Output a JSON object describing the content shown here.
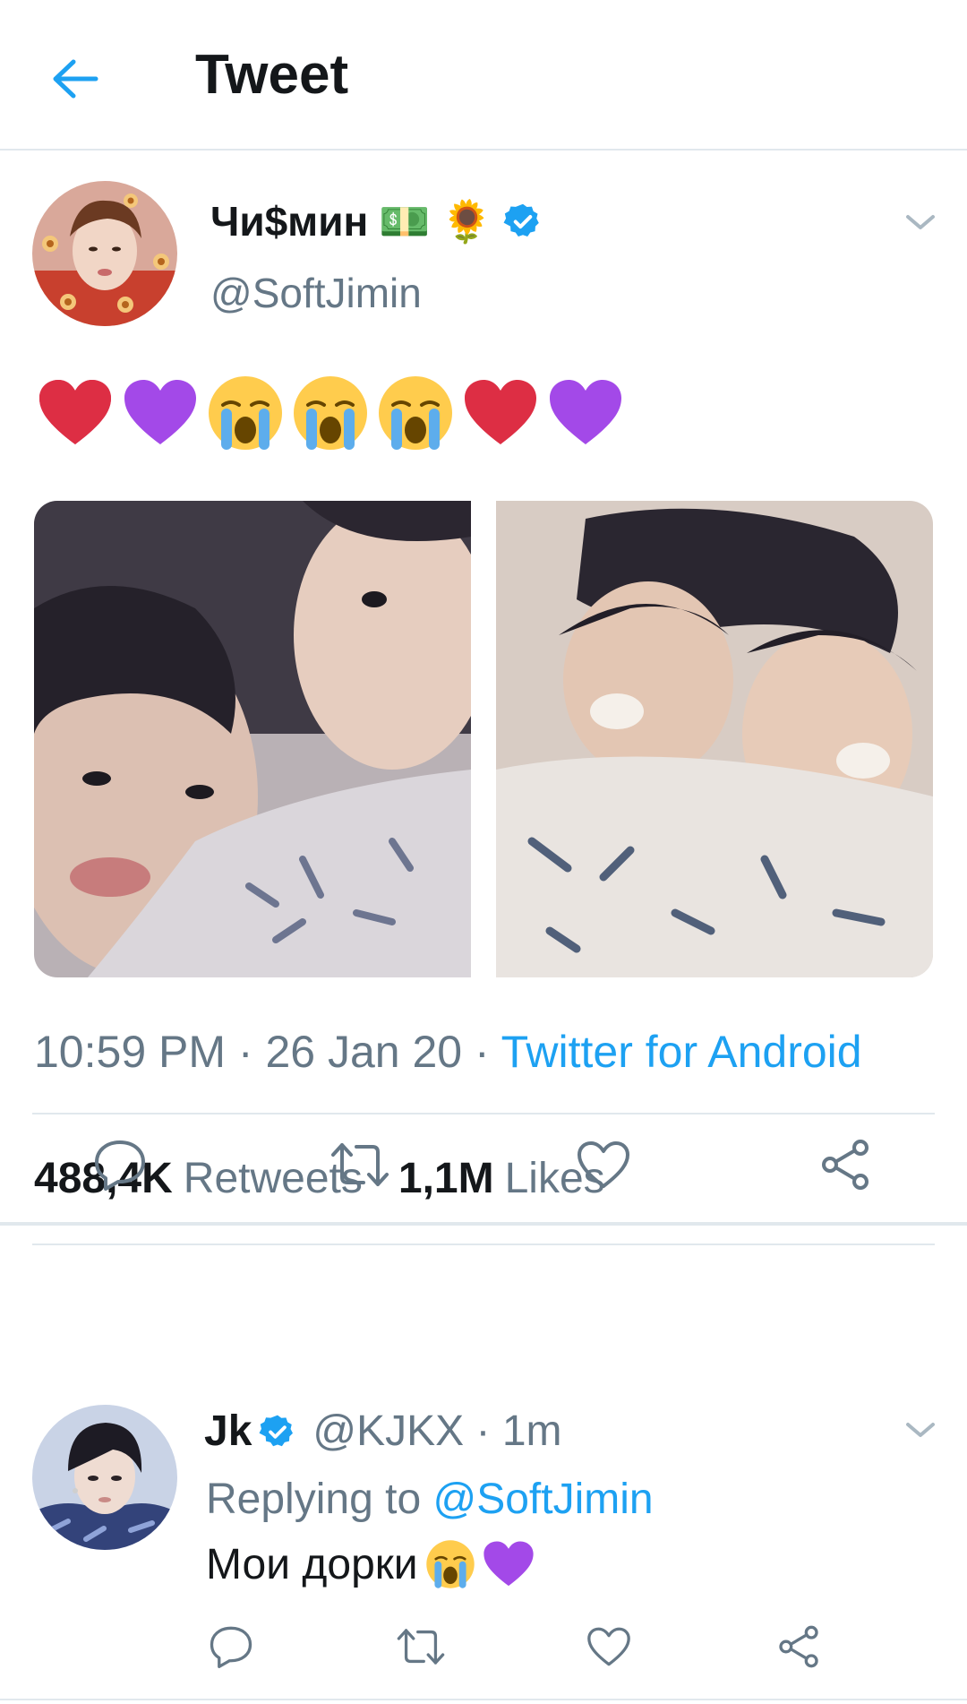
{
  "header": {
    "title": "Tweet",
    "back_icon": "arrow-left-icon",
    "accent": "#1da1f2"
  },
  "tweet": {
    "display_name": "Чи$мин",
    "name_emojis": [
      "💵",
      "🌻"
    ],
    "verified": true,
    "handle": "@SoftJimin",
    "text_emojis": [
      "❤️",
      "💜",
      "😭",
      "😭",
      "😭",
      "❤️",
      "💜"
    ],
    "photos": 2,
    "time": "10:59 PM · 26 Jan 20 · ",
    "source": "Twitter for Android",
    "retweets_count": "488,4K",
    "retweets_label": "Retweets",
    "likes_count": "1,1M",
    "likes_label": "Likes"
  },
  "actions": [
    "comment-icon",
    "retweet-icon",
    "heart-icon",
    "share-icon"
  ],
  "reply": {
    "display_name": "Jk",
    "verified": true,
    "handle": "@KJKX · 1m",
    "replying_label": "Replying to ",
    "replying_mention": "@SoftJimin",
    "text": "Мои дорки",
    "text_emojis": [
      "😭",
      "💜"
    ]
  },
  "colors": {
    "text": "#14171a",
    "secondary": "#657786",
    "link": "#1da1f2",
    "divider": "#e1e8ed",
    "heart": "#e0245e",
    "purple_heart": "#a349e8"
  }
}
